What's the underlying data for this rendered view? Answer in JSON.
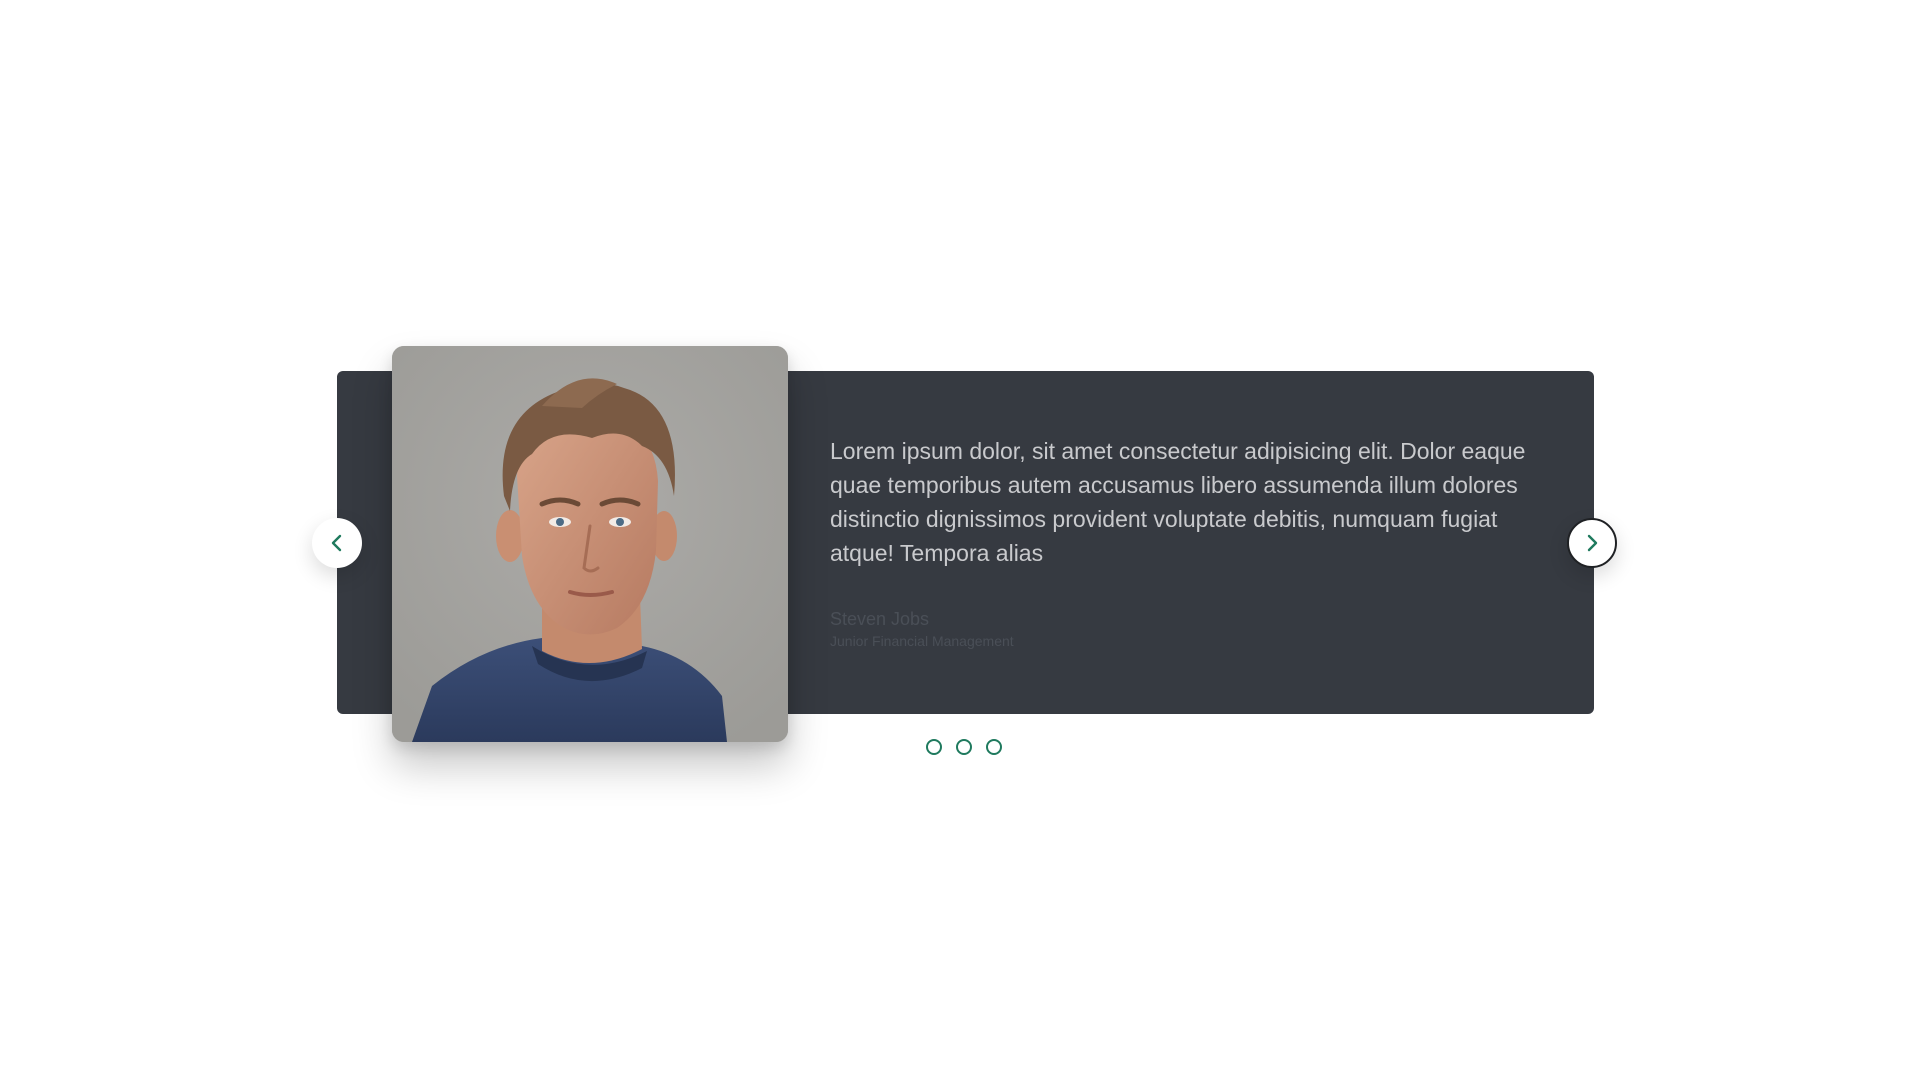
{
  "testimonial": {
    "quote": "Lorem ipsum dolor, sit amet consectetur adipisicing elit. Dolor eaque quae temporibus autem accusamus libero assumenda illum dolores distinctio dignissimos provident voluptate debitis, numquam fugiat atque! Tempora alias",
    "author_name": "Steven Jobs",
    "author_role": "Junior Financial Management",
    "photo_alt": "Portrait of a young man with tousled brown hair wearing a navy t-shirt"
  },
  "navigation": {
    "prev_icon": "chevron-left-icon",
    "next_icon": "chevron-right-icon"
  },
  "pagination": {
    "dots": [
      "slide-1",
      "slide-2",
      "slide-3"
    ],
    "active_index": null
  },
  "colors": {
    "card_background": "#363a41",
    "accent_green": "#1f7a5e",
    "quote_text": "#c9cacd",
    "muted_text": "#4a4f57",
    "page_background": "#ffffff"
  }
}
